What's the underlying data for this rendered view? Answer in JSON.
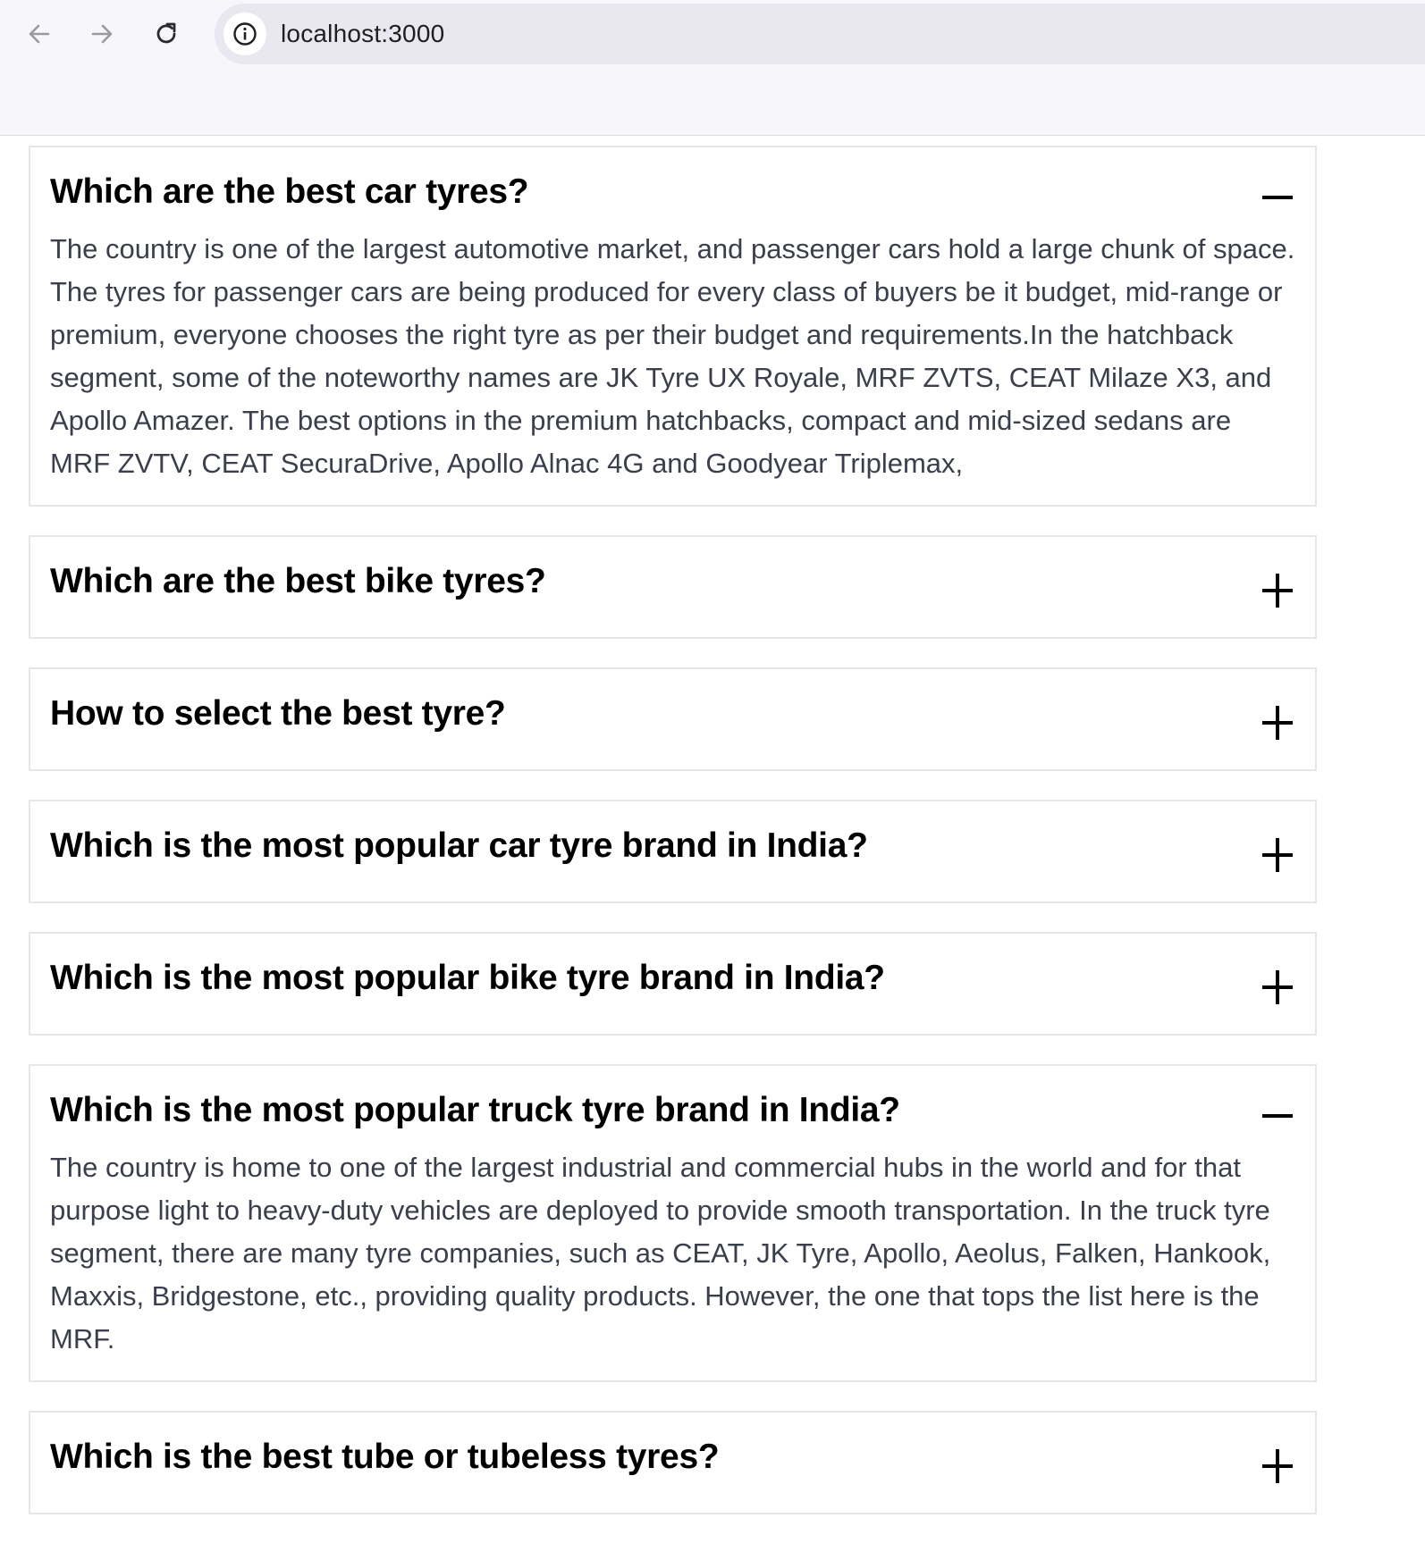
{
  "browser": {
    "url": "localhost:3000",
    "icons": {
      "back": "arrow-left-icon",
      "forward": "arrow-right-icon",
      "reload": "reload-icon",
      "site_info": "info-icon"
    }
  },
  "faq": {
    "items": [
      {
        "question": "Which are the best car tyres?",
        "expanded": true,
        "answer": "The country is one of the largest automotive market, and passenger cars hold a large chunk of space. The tyres for passenger cars are being produced for every class of buyers be it budget, mid-range or premium, everyone chooses the right tyre as per their budget and requirements.In the hatchback segment, some of the noteworthy names are JK Tyre UX Royale, MRF ZVTS, CEAT Milaze X3, and Apollo Amazer. The best options in the premium hatchbacks, compact and mid-sized sedans are MRF ZVTV, CEAT SecuraDrive, Apollo Alnac 4G and Goodyear Triplemax,"
      },
      {
        "question": "Which are the best bike tyres?",
        "expanded": false
      },
      {
        "question": "How to select the best tyre?",
        "expanded": false
      },
      {
        "question": "Which is the most popular car tyre brand in India?",
        "expanded": false
      },
      {
        "question": "Which is the most popular bike tyre brand in India?",
        "expanded": false
      },
      {
        "question": "Which is the most popular truck tyre brand in India?",
        "expanded": true,
        "answer": "The country is home to one of the largest industrial and commercial hubs in the world and for that purpose light to heavy-duty vehicles are deployed to provide smooth transportation. In the truck tyre segment, there are many tyre companies, such as CEAT, JK Tyre, Apollo, Aeolus, Falken, Hankook, Maxxis, Bridgestone, etc., providing quality products. However, the one that tops the list here is the MRF."
      },
      {
        "question": "Which is the best tube or tubeless tyres?",
        "expanded": false
      }
    ]
  }
}
